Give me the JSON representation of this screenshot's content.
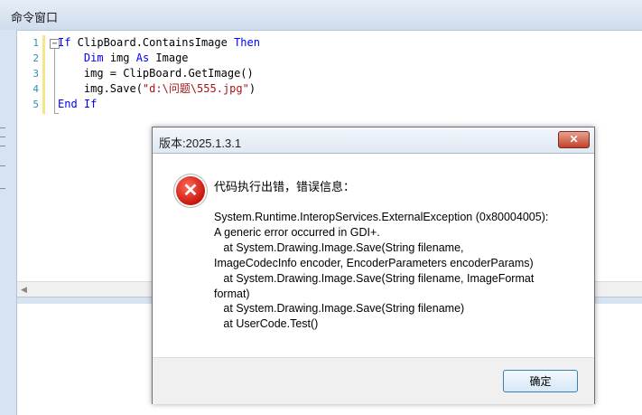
{
  "window": {
    "title": "命令窗口"
  },
  "editor": {
    "line_numbers": [
      "1",
      "2",
      "3",
      "4",
      "5"
    ],
    "lines": [
      [
        {
          "t": "If",
          "k": "kw"
        },
        {
          "t": " ClipBoard.ContainsImage ",
          "k": ""
        },
        {
          "t": "Then",
          "k": "kw"
        }
      ],
      [
        {
          "t": "    ",
          "k": ""
        },
        {
          "t": "Dim",
          "k": "kw"
        },
        {
          "t": " img ",
          "k": ""
        },
        {
          "t": "As",
          "k": "kw"
        },
        {
          "t": " Image",
          "k": ""
        }
      ],
      [
        {
          "t": "    img = ClipBoard.GetImage()",
          "k": ""
        }
      ],
      [
        {
          "t": "    img.Save(",
          "k": ""
        },
        {
          "t": "\"d:\\问题\\555.jpg\"",
          "k": "str"
        },
        {
          "t": ")",
          "k": ""
        }
      ],
      [
        {
          "t": "End If",
          "k": "kw"
        }
      ]
    ],
    "fold_symbol": "−"
  },
  "dialog": {
    "title": "版本:2025.1.3.1",
    "close_label": "✕",
    "icon_glyph": "✕",
    "heading": "代码执行出错，错误信息：",
    "message": "System.Runtime.InteropServices.ExternalException (0x80004005):\nA generic error occurred in GDI+.\n   at System.Drawing.Image.Save(String filename,\nImageCodecInfo encoder, EncoderParameters encoderParams)\n   at System.Drawing.Image.Save(String filename, ImageFormat\nformat)\n   at System.Drawing.Image.Save(String filename)\n   at UserCode.Test()",
    "ok_label": "确定"
  },
  "colors": {
    "keyword": "#0000ff",
    "string": "#a31515",
    "line_number": "#2b91af"
  }
}
